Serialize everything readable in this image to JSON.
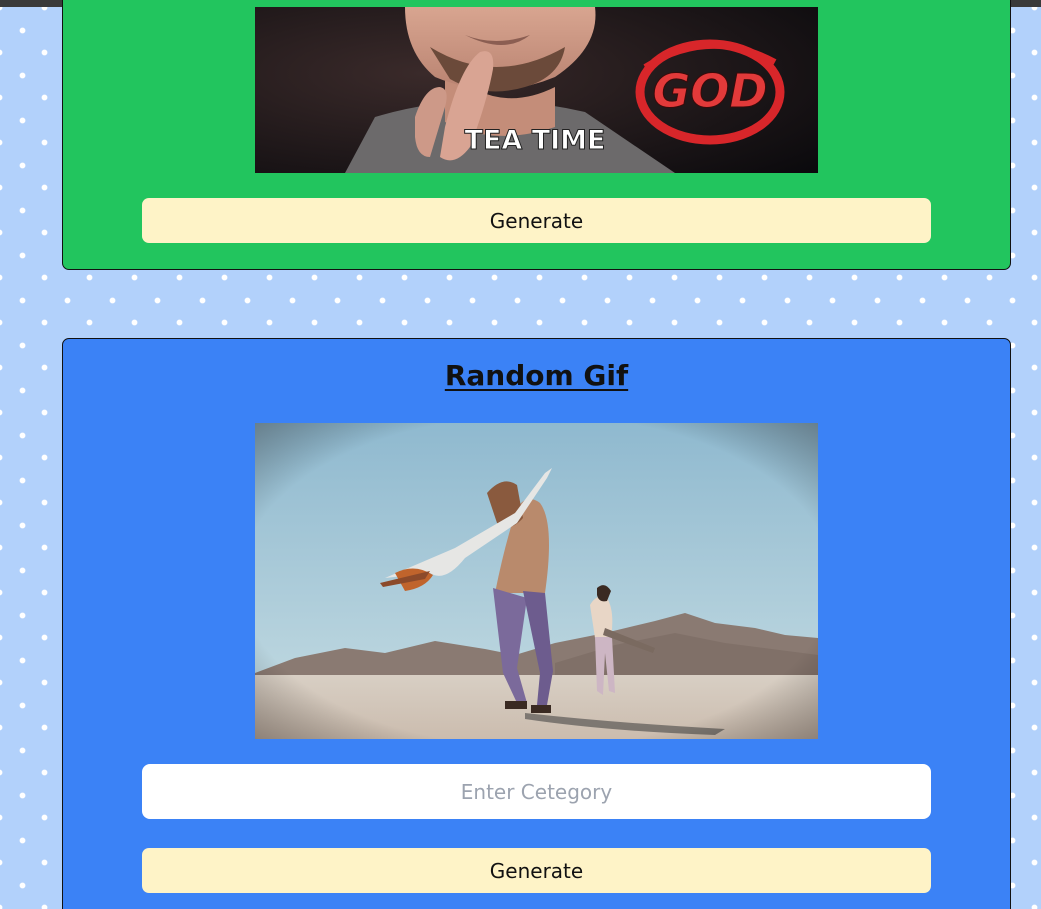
{
  "colors": {
    "background": "#b2d1fb",
    "card_green": "#22c55e",
    "card_blue": "#3b82f6",
    "button_bg": "#fef3c7"
  },
  "tag_card": {
    "gif_caption": "TEA TIME",
    "gif_logo_text": "GOD",
    "generate_label": "Generate"
  },
  "random_card": {
    "title": "Random Gif",
    "category_input": {
      "placeholder": "Enter Cetegory",
      "value": ""
    },
    "generate_label": "Generate"
  }
}
